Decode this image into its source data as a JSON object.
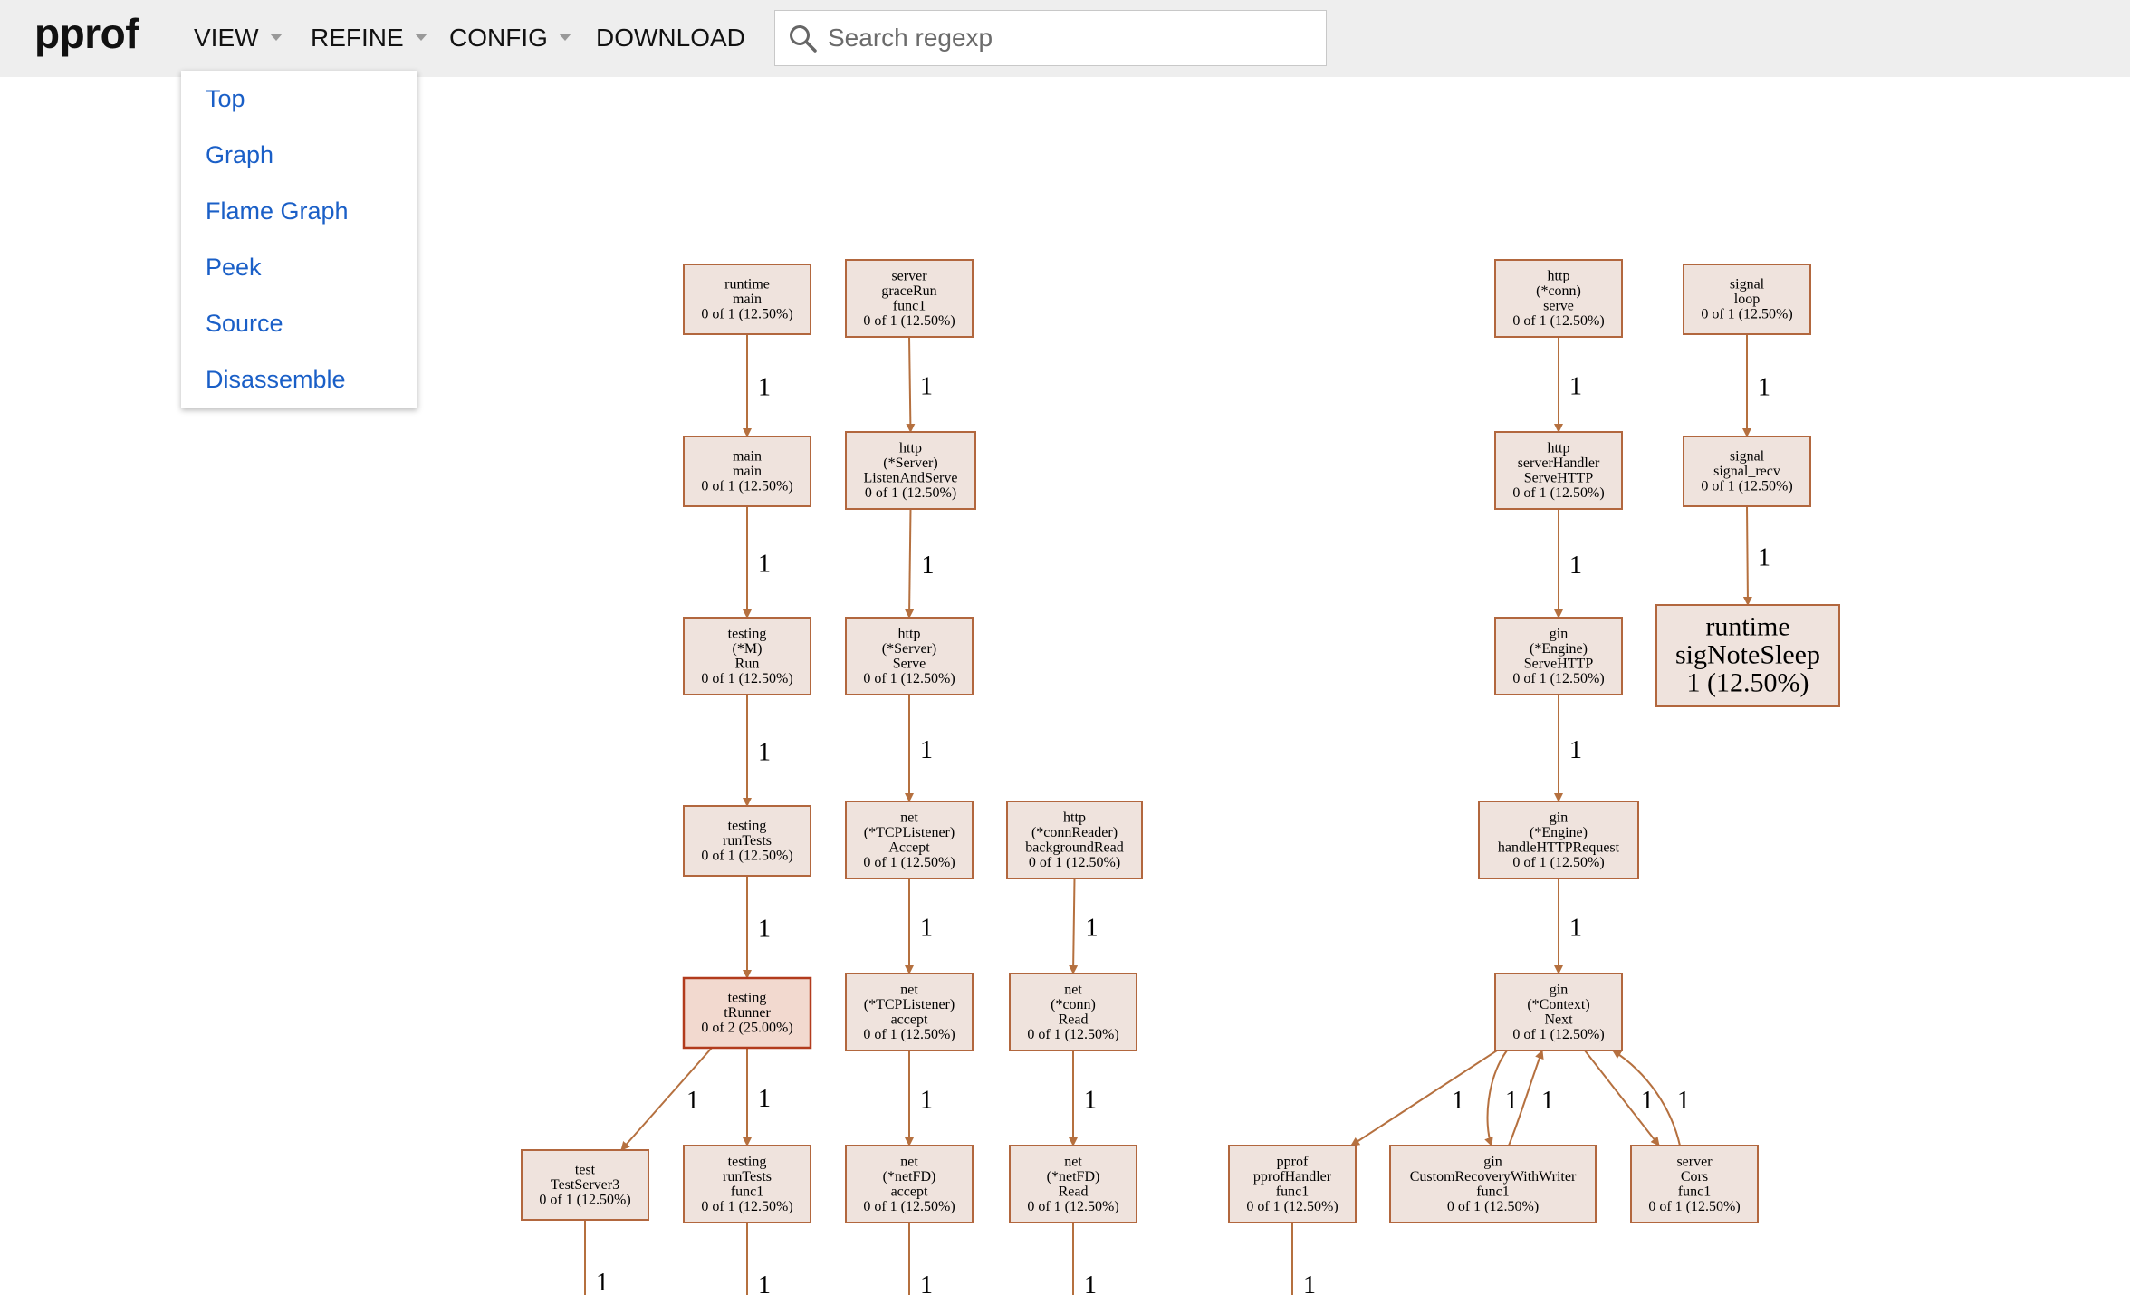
{
  "app": {
    "logo": "pprof"
  },
  "menu": {
    "view": "VIEW",
    "refine": "REFINE",
    "config": "CONFIG",
    "download": "DOWNLOAD"
  },
  "search": {
    "placeholder": "Search regexp",
    "value": "",
    "icon": "search-icon"
  },
  "view_menu": {
    "items": [
      "Top",
      "Graph",
      "Flame Graph",
      "Peek",
      "Source",
      "Disassemble"
    ]
  },
  "graph": {
    "nodes": [
      {
        "id": "n1",
        "lines": [
          "runtime",
          "main",
          "0 of 1 (12.50%)"
        ]
      },
      {
        "id": "n2",
        "lines": [
          "main",
          "main",
          "0 of 1 (12.50%)"
        ]
      },
      {
        "id": "n3",
        "lines": [
          "testing",
          "(*M)",
          "Run",
          "0 of 1 (12.50%)"
        ]
      },
      {
        "id": "n4",
        "lines": [
          "testing",
          "runTests",
          "0 of 1 (12.50%)"
        ]
      },
      {
        "id": "n5",
        "lines": [
          "testing",
          "tRunner",
          "0 of 2 (25.00%)"
        ],
        "hot": true
      },
      {
        "id": "n6",
        "lines": [
          "test",
          "TestServer3",
          "0 of 1 (12.50%)"
        ]
      },
      {
        "id": "n7",
        "lines": [
          "testing",
          "runTests",
          "func1",
          "0 of 1 (12.50%)"
        ]
      },
      {
        "id": "n8",
        "lines": [
          "server",
          "graceRun",
          "func1",
          "0 of 1 (12.50%)"
        ]
      },
      {
        "id": "n9",
        "lines": [
          "http",
          "(*Server)",
          "ListenAndServe",
          "0 of 1 (12.50%)"
        ]
      },
      {
        "id": "n10",
        "lines": [
          "http",
          "(*Server)",
          "Serve",
          "0 of 1 (12.50%)"
        ]
      },
      {
        "id": "n11",
        "lines": [
          "net",
          "(*TCPListener)",
          "Accept",
          "0 of 1 (12.50%)"
        ]
      },
      {
        "id": "n12",
        "lines": [
          "net",
          "(*TCPListener)",
          "accept",
          "0 of 1 (12.50%)"
        ]
      },
      {
        "id": "n13",
        "lines": [
          "net",
          "(*netFD)",
          "accept",
          "0 of 1 (12.50%)"
        ]
      },
      {
        "id": "n14",
        "lines": [
          "http",
          "(*connReader)",
          "backgroundRead",
          "0 of 1 (12.50%)"
        ]
      },
      {
        "id": "n15",
        "lines": [
          "net",
          "(*conn)",
          "Read",
          "0 of 1 (12.50%)"
        ]
      },
      {
        "id": "n16",
        "lines": [
          "net",
          "(*netFD)",
          "Read",
          "0 of 1 (12.50%)"
        ]
      },
      {
        "id": "n17",
        "lines": [
          "http",
          "(*conn)",
          "serve",
          "0 of 1 (12.50%)"
        ]
      },
      {
        "id": "n18",
        "lines": [
          "http",
          "serverHandler",
          "ServeHTTP",
          "0 of 1 (12.50%)"
        ]
      },
      {
        "id": "n19",
        "lines": [
          "gin",
          "(*Engine)",
          "ServeHTTP",
          "0 of 1 (12.50%)"
        ]
      },
      {
        "id": "n20",
        "lines": [
          "gin",
          "(*Engine)",
          "handleHTTPRequest",
          "0 of 1 (12.50%)"
        ]
      },
      {
        "id": "n21",
        "lines": [
          "gin",
          "(*Context)",
          "Next",
          "0 of 1 (12.50%)"
        ]
      },
      {
        "id": "n22",
        "lines": [
          "pprof",
          "pprofHandler",
          "func1",
          "0 of 1 (12.50%)"
        ]
      },
      {
        "id": "n23",
        "lines": [
          "gin",
          "CustomRecoveryWithWriter",
          "func1",
          "0 of 1 (12.50%)"
        ]
      },
      {
        "id": "n24",
        "lines": [
          "server",
          "Cors",
          "func1",
          "0 of 1 (12.50%)"
        ]
      },
      {
        "id": "n25",
        "lines": [
          "signal",
          "loop",
          "0 of 1 (12.50%)"
        ]
      },
      {
        "id": "n26",
        "lines": [
          "signal",
          "signal_recv",
          "0 of 1 (12.50%)"
        ]
      },
      {
        "id": "n27",
        "lines": [
          "runtime",
          "sigNoteSleep",
          "1 (12.50%)"
        ],
        "big": true
      }
    ],
    "edges": [
      {
        "from": "n1",
        "to": "n2",
        "label": "1"
      },
      {
        "from": "n2",
        "to": "n3",
        "label": "1"
      },
      {
        "from": "n3",
        "to": "n4",
        "label": "1"
      },
      {
        "from": "n4",
        "to": "n5",
        "label": "1"
      },
      {
        "from": "n5",
        "to": "n6",
        "label": "1"
      },
      {
        "from": "n5",
        "to": "n7",
        "label": "1"
      },
      {
        "from": "n6",
        "to": null,
        "label": "1"
      },
      {
        "from": "n7",
        "to": null,
        "label": "1"
      },
      {
        "from": "n8",
        "to": "n9",
        "label": "1"
      },
      {
        "from": "n9",
        "to": "n10",
        "label": "1"
      },
      {
        "from": "n10",
        "to": "n11",
        "label": "1"
      },
      {
        "from": "n11",
        "to": "n12",
        "label": "1"
      },
      {
        "from": "n12",
        "to": "n13",
        "label": "1"
      },
      {
        "from": "n13",
        "to": null,
        "label": "1"
      },
      {
        "from": "n14",
        "to": "n15",
        "label": "1"
      },
      {
        "from": "n15",
        "to": "n16",
        "label": "1"
      },
      {
        "from": "n16",
        "to": null,
        "label": "1"
      },
      {
        "from": "n17",
        "to": "n18",
        "label": "1"
      },
      {
        "from": "n18",
        "to": "n19",
        "label": "1"
      },
      {
        "from": "n19",
        "to": "n20",
        "label": "1"
      },
      {
        "from": "n20",
        "to": "n21",
        "label": "1"
      },
      {
        "from": "n21",
        "to": "n22",
        "label": "1"
      },
      {
        "from": "n21",
        "to": "n23",
        "label": "1"
      },
      {
        "from": "n23",
        "to": "n21",
        "label": "1"
      },
      {
        "from": "n21",
        "to": "n24",
        "label": "1"
      },
      {
        "from": "n24",
        "to": "n21",
        "label": "1"
      },
      {
        "from": "n22",
        "to": null,
        "label": "1"
      },
      {
        "from": "n25",
        "to": "n26",
        "label": "1"
      },
      {
        "from": "n26",
        "to": "n27",
        "label": "1"
      }
    ]
  },
  "colors": {
    "topbar": "#eeeeee",
    "link": "#1a5fc7",
    "node_fill": "#efe3dd",
    "node_fill_hot": "#f2d9cf",
    "node_stroke": "#b2673e",
    "node_stroke_hot": "#b23b1d",
    "edge": "#b5703f"
  }
}
